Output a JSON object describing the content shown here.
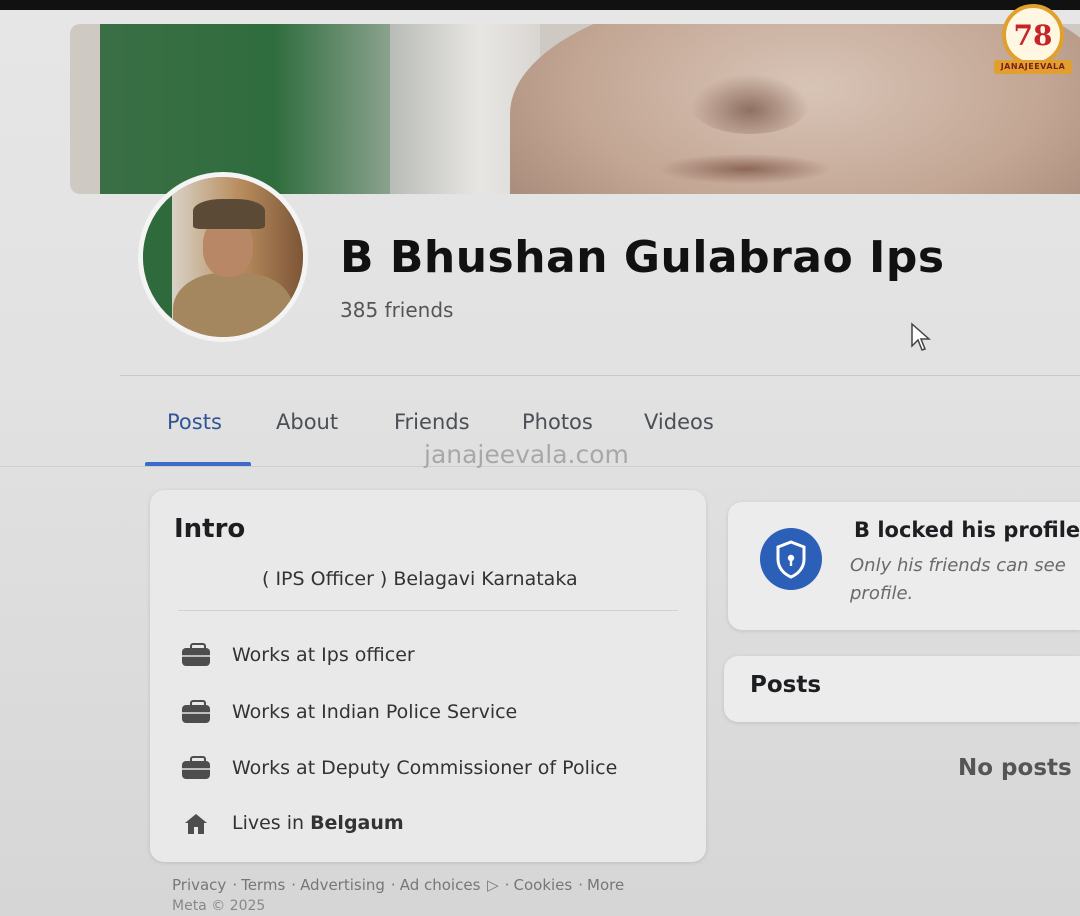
{
  "profile": {
    "name": "B Bhushan Gulabrao Ips",
    "friends": "385 friends"
  },
  "watermark_logo": {
    "number": "78",
    "text": "JANAJEEVALA"
  },
  "watermark_text": "janajeevala.com",
  "tabs": [
    {
      "label": "Posts",
      "active": true
    },
    {
      "label": "About"
    },
    {
      "label": "Friends"
    },
    {
      "label": "Photos"
    },
    {
      "label": "Videos"
    }
  ],
  "intro": {
    "title": "Intro",
    "bio": "( IPS Officer ) Belagavi Karnataka",
    "items": [
      {
        "icon": "briefcase-icon",
        "text": "Works at Ips officer"
      },
      {
        "icon": "briefcase-icon",
        "text": "Works at Indian Police Service"
      },
      {
        "icon": "briefcase-icon",
        "text": "Works at Deputy Commissioner of Police"
      },
      {
        "icon": "home-icon",
        "prefix": "Lives in",
        "place": "Belgaum"
      }
    ]
  },
  "locked": {
    "title": "B locked his profile",
    "subtitle": "Only his friends can see profile."
  },
  "posts": {
    "title": "Posts",
    "empty": "No posts"
  },
  "footer": {
    "links": [
      "Privacy",
      "Terms",
      "Advertising",
      "Ad choices",
      "Cookies",
      "More"
    ],
    "meta": "Meta © 2025"
  },
  "colors": {
    "accent": "#3a6cc8",
    "shield": "#2b5fb8"
  }
}
